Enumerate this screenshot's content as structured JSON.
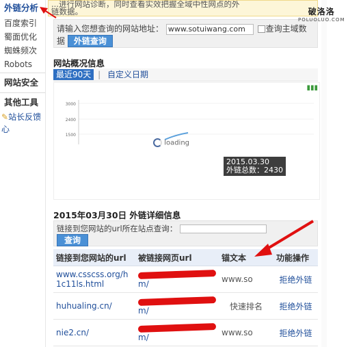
{
  "sidebar": {
    "active_head": "外链分析",
    "items": [
      "百度索引",
      "蜀面优化",
      "蜘蛛频次",
      "Robots"
    ],
    "sections": [
      "网站安全",
      "其他工具"
    ],
    "feedback": "站长反馈心"
  },
  "notice": {
    "line1": "...进行网站诊断，同时查看实效把握全域中性网点的外",
    "line2": "链数据。"
  },
  "query": {
    "label": "请输入您想查询的网站地址：",
    "url_value": "www.sotuiwang.com",
    "checkbox_label": "查询主域数",
    "label_cont": "据",
    "button": "外链查询"
  },
  "overview": {
    "title": "网站概况信息",
    "tab_active": "最近90天",
    "tab_divider": "|",
    "tab_custom": "自定义日期"
  },
  "chart_data": {
    "type": "line",
    "title": "",
    "xlabel": "",
    "ylabel": "",
    "y_ticks": [
      "3000",
      "2400",
      "1500"
    ],
    "series": [
      {
        "values": []
      }
    ],
    "tooltip_date": "2015.03.30",
    "tooltip_value_label": "外链总数：2430",
    "loading_text": "loading"
  },
  "detail": {
    "title": "2015年03月30日 外链详细信息",
    "search_label": "链接到您网站的url所在站点查询：",
    "search_button": "查询",
    "columns": [
      "链接到您网站的url",
      "被链接网页url",
      "锚文本",
      "功能操作"
    ],
    "rows": [
      {
        "source_url": "www.csscss.org/h1c11ls.html",
        "target_url": "www.sotuiwang.com/",
        "anchor": "www.so",
        "action": "拒绝外链"
      },
      {
        "source_url": "huhualing.cn/",
        "target_url": "www.sotuiwang.com/",
        "anchor": "快速排名",
        "action": "拒绝外链"
      },
      {
        "source_url": "nie2.cn/",
        "target_url": "www.sotuiwang.com/",
        "anchor": "www.so",
        "action": "拒绝外链"
      }
    ]
  },
  "watermark": {
    "cn": "破洛洛",
    "en": "POLUOLUO.COM"
  },
  "colors": {
    "accent": "#2e6fc2",
    "link": "#1f4e9a",
    "annotation_arrow": "#e01010",
    "notice_bg": "#fdf6d8"
  }
}
